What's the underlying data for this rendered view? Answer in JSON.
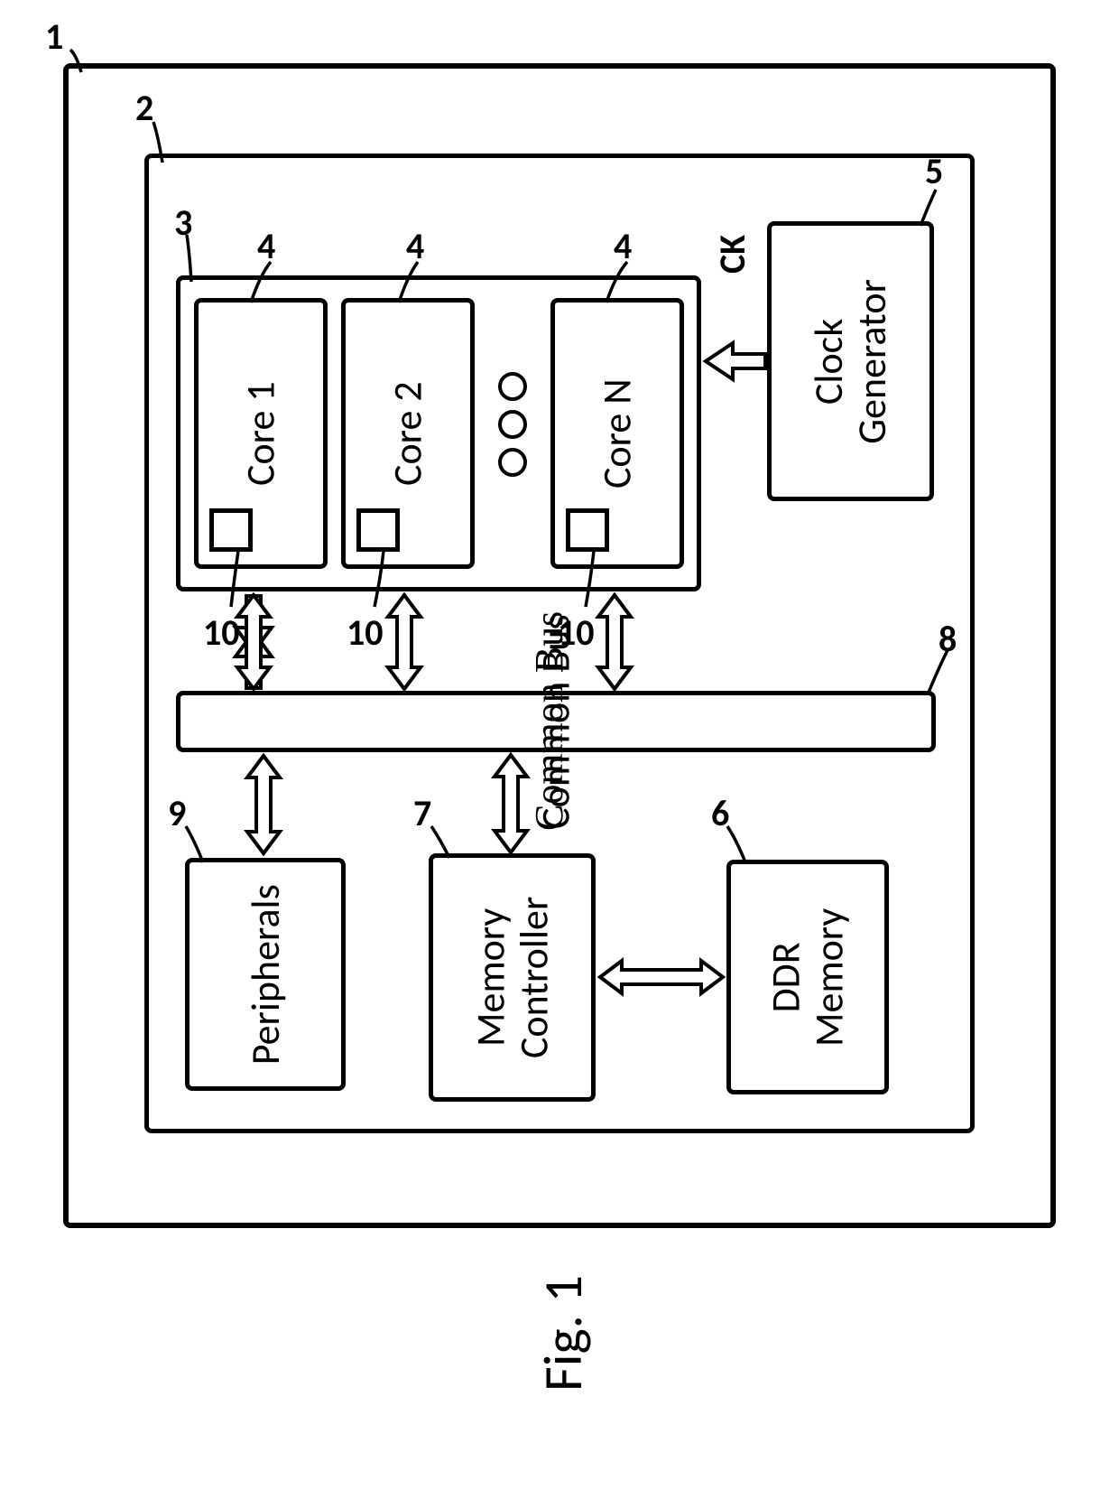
{
  "outer_ref": "1",
  "inner_ref": "2",
  "cpu_block_ref": "3",
  "core1": {
    "label": "Core 1",
    "ref": "4",
    "cache_ref": "10"
  },
  "core2": {
    "label": "Core 2",
    "ref": "4",
    "cache_ref": "10"
  },
  "coreN": {
    "label": "Core N",
    "ref": "4",
    "cache_ref": "10"
  },
  "clock": {
    "label": "Clock\nGenerator",
    "ref": "5",
    "signal": "CK"
  },
  "bus": {
    "label": "Common Bus",
    "ref": "8"
  },
  "peripherals": {
    "label": "Peripherals",
    "ref": "9"
  },
  "memctrl": {
    "label": "Memory\nController",
    "ref": "7"
  },
  "ddr": {
    "label": "DDR\nMemory",
    "ref": "6"
  },
  "figure": "Fig. 1"
}
